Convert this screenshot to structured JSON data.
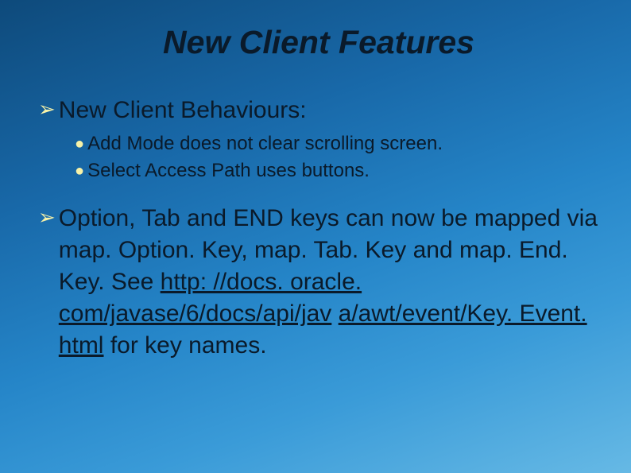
{
  "title": "New Client Features",
  "bullet1": {
    "heading": "New Client Behaviours:",
    "subs": {
      "s1": "Add Mode does not clear scrolling screen.",
      "s2": "Select Access Path uses buttons."
    }
  },
  "bullet2": {
    "part1": "Option, Tab and END keys can now be mapped via map. Option. Key, map. Tab. Key and map. End. Key. See ",
    "link1": "http: //docs. oracle. com/javase/6/docs/api/jav",
    "link2": "a/awt/event/Key. Event. html",
    "part2": " for key names."
  }
}
